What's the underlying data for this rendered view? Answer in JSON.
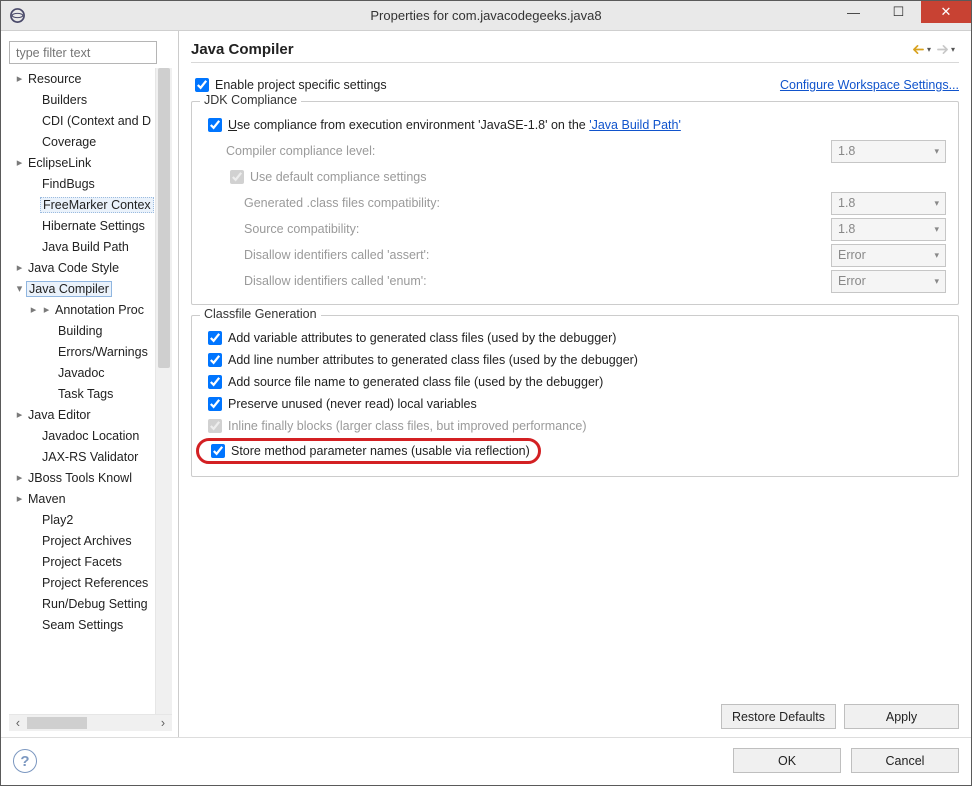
{
  "window": {
    "title": "Properties for com.javacodegeeks.java8"
  },
  "filter": {
    "placeholder": "type filter text"
  },
  "tree": {
    "items": [
      {
        "label": "Resource",
        "depth": 0,
        "tw": "›"
      },
      {
        "label": "Builders",
        "depth": 1,
        "tw": ""
      },
      {
        "label": "CDI (Context and D",
        "depth": 1,
        "tw": ""
      },
      {
        "label": "Coverage",
        "depth": 1,
        "tw": ""
      },
      {
        "label": "EclipseLink",
        "depth": 0,
        "tw": "›"
      },
      {
        "label": "FindBugs",
        "depth": 1,
        "tw": ""
      },
      {
        "label": "FreeMarker Contex",
        "depth": 1,
        "tw": "",
        "selected": true
      },
      {
        "label": "Hibernate Settings",
        "depth": 1,
        "tw": ""
      },
      {
        "label": "Java Build Path",
        "depth": 1,
        "tw": ""
      },
      {
        "label": "Java Code Style",
        "depth": 0,
        "tw": "›"
      },
      {
        "label": "Java Compiler",
        "depth": 0,
        "tw": "⌄",
        "expandedsel": true
      },
      {
        "label": "Annotation Proc",
        "depth": 1,
        "tw": "›",
        "extra": true
      },
      {
        "label": "Building",
        "depth": 2,
        "tw": ""
      },
      {
        "label": "Errors/Warnings",
        "depth": 2,
        "tw": ""
      },
      {
        "label": "Javadoc",
        "depth": 2,
        "tw": ""
      },
      {
        "label": "Task Tags",
        "depth": 2,
        "tw": ""
      },
      {
        "label": "Java Editor",
        "depth": 0,
        "tw": "›"
      },
      {
        "label": "Javadoc Location",
        "depth": 1,
        "tw": ""
      },
      {
        "label": "JAX-RS Validator",
        "depth": 1,
        "tw": ""
      },
      {
        "label": "JBoss Tools Knowl",
        "depth": 0,
        "tw": "›"
      },
      {
        "label": "Maven",
        "depth": 0,
        "tw": "›"
      },
      {
        "label": "Play2",
        "depth": 1,
        "tw": ""
      },
      {
        "label": "Project Archives",
        "depth": 1,
        "tw": ""
      },
      {
        "label": "Project Facets",
        "depth": 1,
        "tw": ""
      },
      {
        "label": "Project References",
        "depth": 1,
        "tw": ""
      },
      {
        "label": "Run/Debug Setting",
        "depth": 1,
        "tw": ""
      },
      {
        "label": "Seam Settings",
        "depth": 1,
        "tw": ""
      }
    ]
  },
  "page": {
    "title": "Java Compiler",
    "enable_label": "Enable project specific settings",
    "configure_link": "Configure Workspace Settings..."
  },
  "jdk": {
    "title": "JDK Compliance",
    "use_env_prefix": "Use compliance from execution environment 'JavaSE-1.8' on the ",
    "use_env_underline": "U",
    "build_path_link": "'Java Build Path'",
    "compliance_level_label": "Compiler compliance level:",
    "compliance_level_value": "1.8",
    "use_default_label": "Use default compliance settings",
    "gen_class_label": "Generated .class files compatibility:",
    "gen_class_value": "1.8",
    "source_compat_label": "Source compatibility:",
    "source_compat_value": "1.8",
    "disallow_assert_label": "Disallow identifiers called 'assert':",
    "disallow_assert_value": "Error",
    "disallow_enum_label": "Disallow identifiers called 'enum':",
    "disallow_enum_value": "Error"
  },
  "classfile": {
    "title": "Classfile Generation",
    "opt1": "Add variable attributes to generated class files (used by the debugger)",
    "opt2": "Add line number attributes to generated class files (used by the debugger)",
    "opt3": "Add source file name to generated class file (used by the debugger)",
    "opt4": "Preserve unused (never read) local variables",
    "opt5": "Inline finally blocks (larger class files, but improved performance)",
    "opt6": "Store method parameter names (usable via reflection)"
  },
  "buttons": {
    "restore": "Restore Defaults",
    "apply": "Apply",
    "ok": "OK",
    "cancel": "Cancel"
  }
}
